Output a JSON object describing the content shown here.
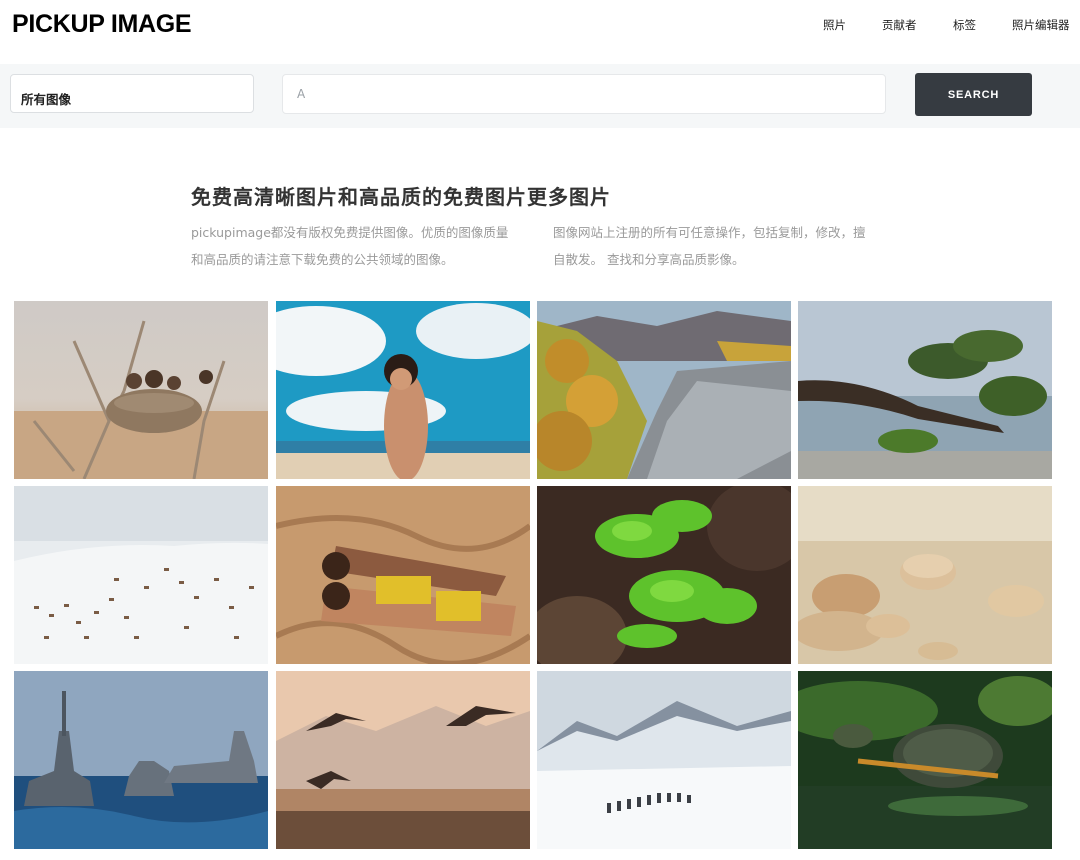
{
  "header": {
    "logo": "PICKUP IMAGE",
    "nav": [
      "照片",
      "贡献者",
      "标签",
      "照片编辑器"
    ]
  },
  "search": {
    "category": "所有图像",
    "query_value": "A",
    "button_label": "SEARCH"
  },
  "intro": {
    "title": "免费高清晰图片和高品质的免费图片更多图片",
    "col1_line1": "pickupimage都没有版权免费提供图像。优质的图像质量",
    "col1_line2": "和高品质的请注意下载免费的公共领域的图像。",
    "col2_line1": "图像网站上注册的所有可任意操作，包括复制，修改，擅",
    "col2_line2": "自散发。 查找和分享高品质影像。"
  },
  "gallery": {
    "images": [
      "eagles-nest-image",
      "beach-woman-image",
      "river-valley-image",
      "lake-pine-tree-image",
      "snowy-herd-image",
      "sand-women-image",
      "green-plant-image",
      "beach-stones-image",
      "warships-image",
      "birds-flying-image",
      "snow-mountain-dogsled-image",
      "turtle-image"
    ]
  }
}
